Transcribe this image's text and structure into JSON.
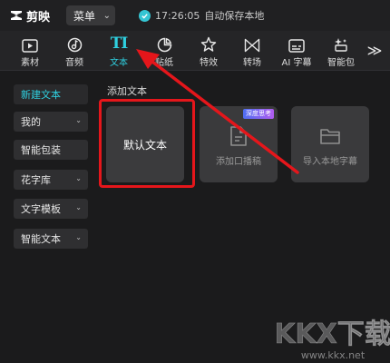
{
  "app": {
    "name": "剪映"
  },
  "titlebar": {
    "menu_label": "菜单",
    "save_time": "17:26:05",
    "save_text": "自动保存本地"
  },
  "toolbar": {
    "tools": [
      {
        "label": "素材",
        "icon": "media-icon"
      },
      {
        "label": "音频",
        "icon": "audio-icon"
      },
      {
        "label": "文本",
        "icon": "text-icon",
        "glyph": "TI",
        "active": true
      },
      {
        "label": "贴纸",
        "icon": "sticker-icon"
      },
      {
        "label": "特效",
        "icon": "effects-icon"
      },
      {
        "label": "转场",
        "icon": "transition-icon"
      },
      {
        "label": "AI 字幕",
        "icon": "ai-subtitle-icon"
      },
      {
        "label": "智能包",
        "icon": "smart-package-icon"
      }
    ],
    "more": "≫"
  },
  "sidebar": {
    "items": [
      {
        "label": "新建文本",
        "active": true
      },
      {
        "label": "我的",
        "dropdown": true
      },
      {
        "label": "智能包装"
      },
      {
        "label": "花字库",
        "dropdown": true
      },
      {
        "label": "文字模板",
        "dropdown": true
      },
      {
        "label": "智能文本",
        "dropdown": true
      }
    ]
  },
  "main": {
    "section_title": "添加文本",
    "cards": [
      {
        "label": "默认文本"
      },
      {
        "label": "添加口播稿",
        "badge": "深度思考",
        "icon": "script-doc-icon"
      },
      {
        "label": "导入本地字幕",
        "icon": "folder-icon"
      }
    ]
  },
  "watermark": {
    "text": "KKX下载",
    "url": "www.kkx.net"
  },
  "colors": {
    "accent": "#2fd0e0",
    "highlight": "#e5161b",
    "background": "#1b1b1c"
  }
}
